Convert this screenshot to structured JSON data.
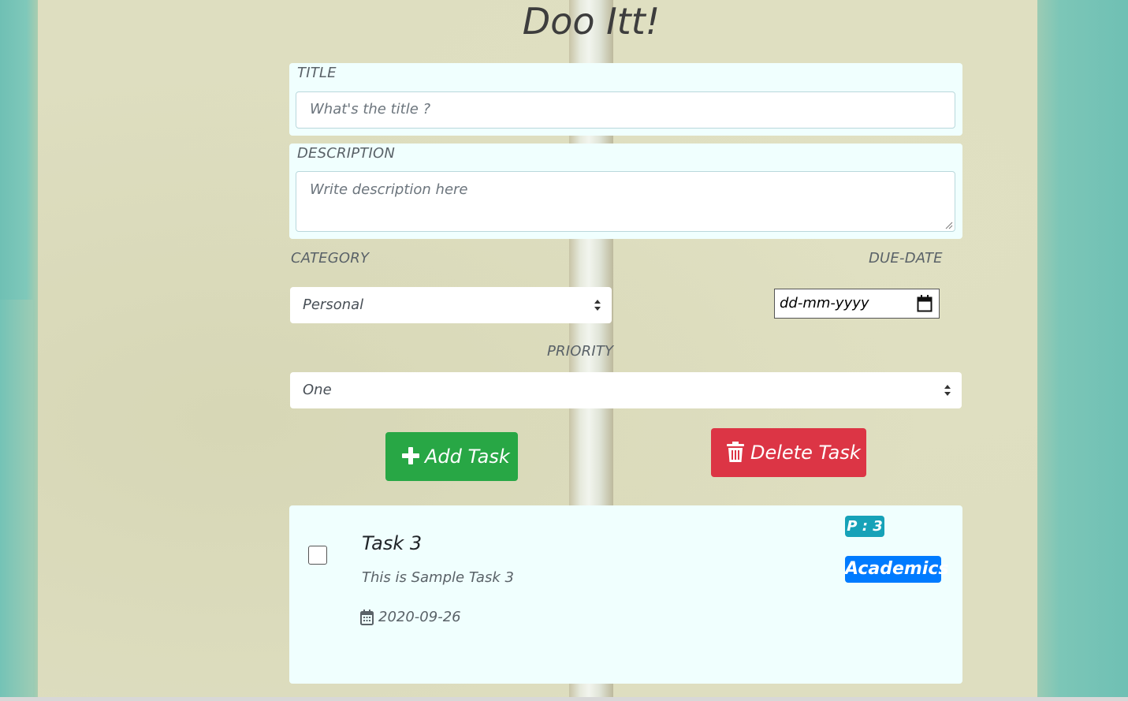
{
  "app": {
    "title": "Doo Itt!"
  },
  "form": {
    "title_label": "TITLE",
    "title_placeholder": "What's the title ?",
    "description_label": "DESCRIPTION",
    "description_placeholder": "Write description here",
    "category_label": "CATEGORY",
    "category_selected": "Personal",
    "duedate_label": "DUE-DATE",
    "duedate_placeholder": "dd-mm-yyyy",
    "priority_label": "PRIORITY",
    "priority_selected": "One"
  },
  "buttons": {
    "add_label": "Add Task",
    "delete_label": "Delete Task"
  },
  "tasks": [
    {
      "title": "Task 3",
      "description": "This is Sample Task 3",
      "date": "2020-09-26",
      "priority_badge": "P : 3",
      "category_badge": "Academics",
      "checked": false
    }
  ],
  "colors": {
    "add_button": "#28a745",
    "delete_button": "#dc3545",
    "priority_badge": "#17a2b8",
    "category_badge": "#007bff",
    "panel_bg": "#f0fffe"
  },
  "icons": {
    "add": "plus-icon",
    "delete": "trash-icon",
    "date": "calendar-icon",
    "select": "select-arrows-icon",
    "datepicker": "calendar-picker-icon"
  }
}
